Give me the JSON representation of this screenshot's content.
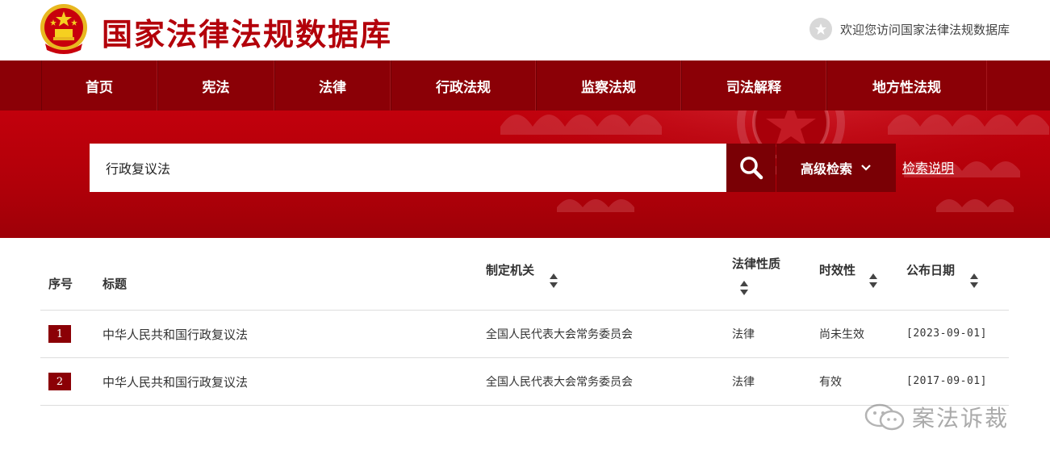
{
  "header": {
    "site_title": "国家法律法规数据库",
    "welcome": "欢迎您访问国家法律法规数据库"
  },
  "nav": {
    "items": [
      {
        "label": "首页"
      },
      {
        "label": "宪法"
      },
      {
        "label": "法律"
      },
      {
        "label": "行政法规"
      },
      {
        "label": "监察法规"
      },
      {
        "label": "司法解释"
      },
      {
        "label": "地方性法规"
      }
    ]
  },
  "search": {
    "value": "行政复议法",
    "advanced_label": "高级检索",
    "help_label": "检索说明"
  },
  "table": {
    "headers": {
      "index": "序号",
      "title": "标题",
      "authority": "制定机关",
      "nature": "法律性质",
      "validity": "时效性",
      "date": "公布日期"
    },
    "rows": [
      {
        "index": "1",
        "title": "中华人民共和国行政复议法",
        "authority": "全国人民代表大会常务委员会",
        "nature": "法律",
        "validity": "尚未生效",
        "date": "[2023-09-01]"
      },
      {
        "index": "2",
        "title": "中华人民共和国行政复议法",
        "authority": "全国人民代表大会常务委员会",
        "nature": "法律",
        "validity": "有效",
        "date": "[2017-09-01]"
      }
    ]
  },
  "watermark": {
    "text": "案法诉裁"
  },
  "colors": {
    "brand_red": "#b3000a",
    "nav_dark_red": "#8b0006",
    "button_dark_red": "#7a0005"
  }
}
